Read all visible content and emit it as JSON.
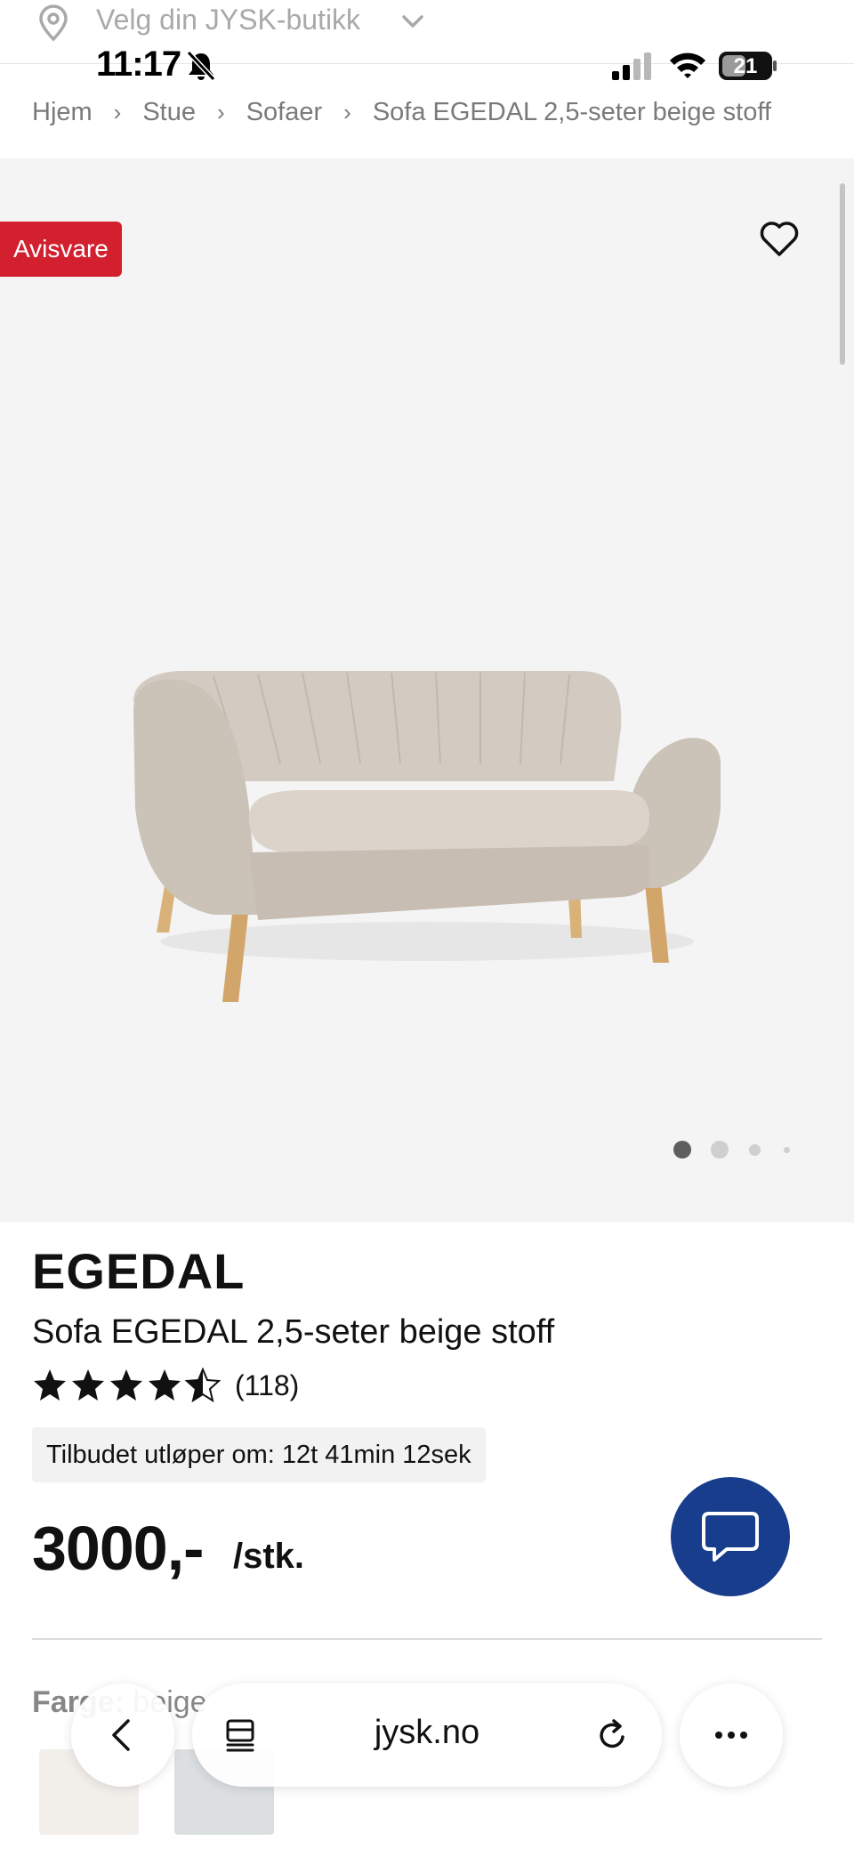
{
  "store_selector": {
    "label": "Velg din JYSK-butikk",
    "icons": [
      "location-pin-icon",
      "chevron-down-icon"
    ]
  },
  "status_bar": {
    "time": "11:17",
    "battery": "21",
    "icons": [
      "bell-slash-icon",
      "signal-icon",
      "wifi-icon",
      "battery-icon"
    ]
  },
  "breadcrumb": [
    "Hjem",
    "Stue",
    "Sofaer",
    "Sofa EGEDAL 2,5-seter beige stoff"
  ],
  "gallery": {
    "badge": "Avisvare",
    "badge_color": "#d2202f",
    "image_count": 4,
    "active_index": 0,
    "icons": [
      "heart-icon"
    ]
  },
  "product": {
    "brand": "EGEDAL",
    "name": "Sofa EGEDAL 2,5-seter beige stoff",
    "rating": 4.5,
    "rating_max": 5,
    "review_count": "(118)",
    "offer_text": "Tilbudet utløper om: 12t 41min 12sek",
    "price": "3000,-",
    "unit": "/stk.",
    "color_label": "Farge:",
    "color_value": "beige"
  },
  "chat": {
    "icon": "chat-bubble-icon",
    "color": "#173d8c"
  },
  "browser": {
    "url": "jysk.no",
    "icons": [
      "back-icon",
      "tabs-icon",
      "reload-icon",
      "more-icon"
    ]
  }
}
